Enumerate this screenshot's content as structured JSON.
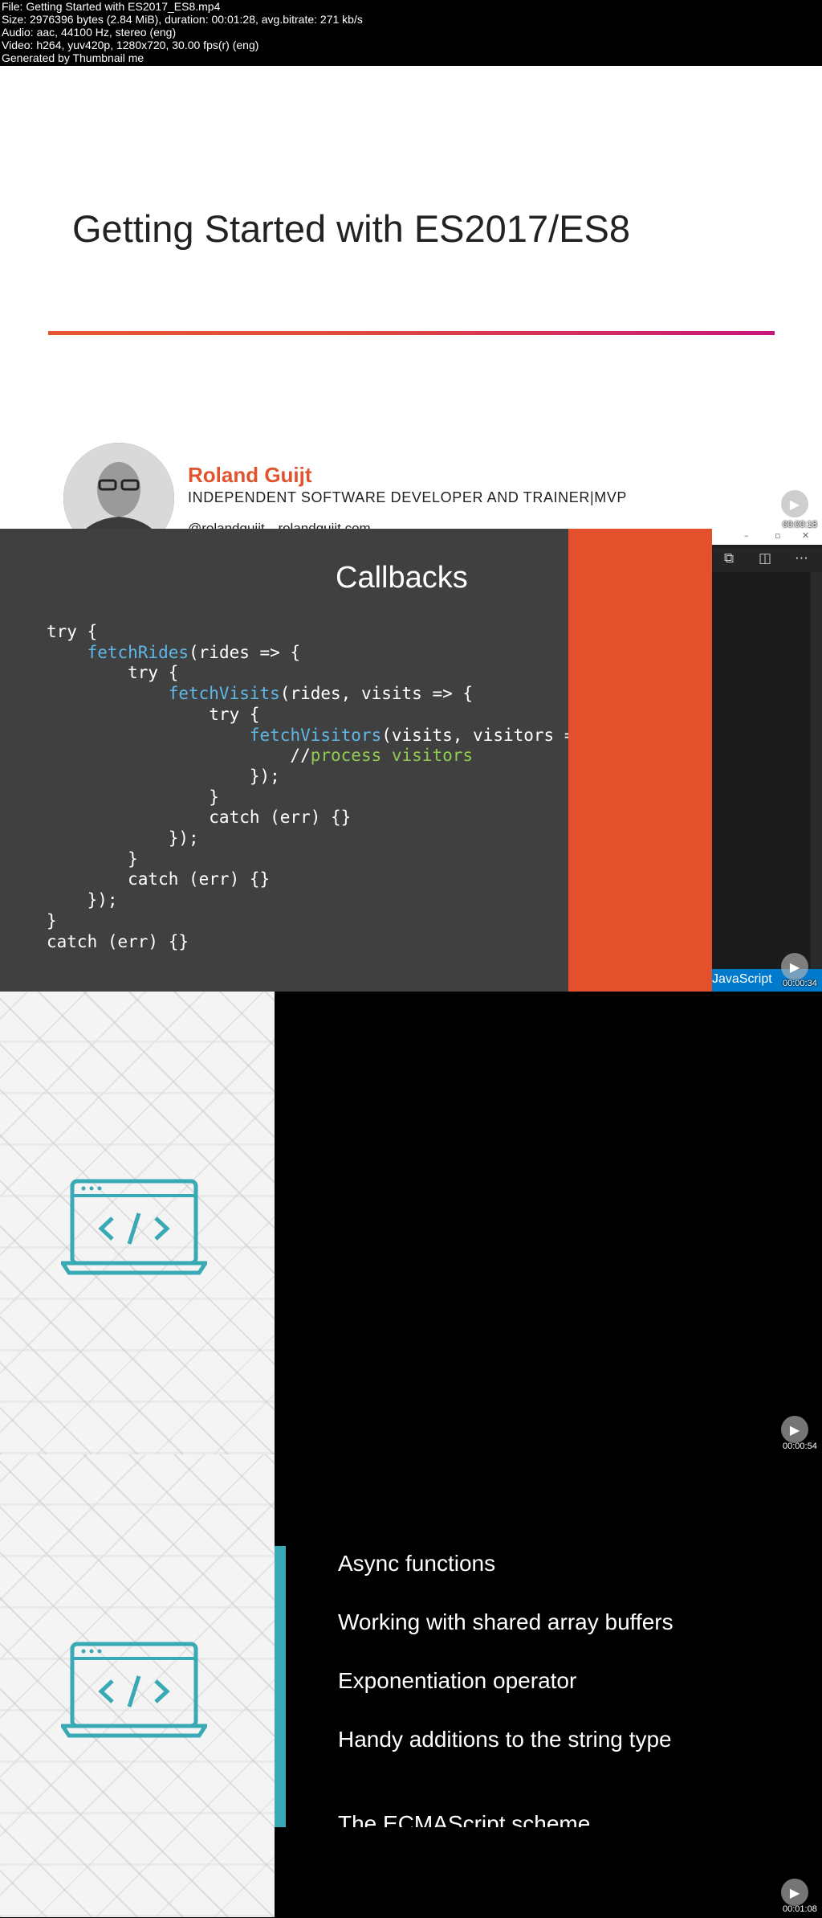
{
  "info": {
    "file": "File: Getting Started with ES2017_ES8.mp4",
    "size": "Size: 2976396 bytes (2.84 MiB), duration: 00:01:28, avg.bitrate: 271 kb/s",
    "audio": "Audio: aac, 44100 Hz, stereo (eng)",
    "video": "Video: h264, yuv420p, 1280x720, 30.00 fps(r) (eng)",
    "generated": "Generated by Thumbnail me"
  },
  "frame1": {
    "title": "Getting Started with ES2017/ES8",
    "name": "Roland Guijt",
    "role": "INDEPENDENT SOFTWARE DEVELOPER AND TRAINER|MVP",
    "twitter": "@rolandguijt",
    "website": "rolandguijt.com",
    "timestamp": "00:00:18"
  },
  "frame2": {
    "title": "Callbacks",
    "status_language": "JavaScript",
    "timestamp": "00:00:34"
  },
  "frame3": {
    "timestamp": "00:00:54"
  },
  "frame4": {
    "bullets": [
      "Async functions",
      "Working with shared array buffers",
      "Exponentiation operator",
      "Handy additions to the string type"
    ],
    "cut_off_bullet": "The ECMAScript scheme",
    "timestamp": "00:01:08"
  },
  "colors": {
    "accent_orange": "#e2502c",
    "name_orange": "#e0552f",
    "teal": "#39a9b6",
    "code_function": "#5fb7e6",
    "code_comment": "#8fcb52"
  }
}
